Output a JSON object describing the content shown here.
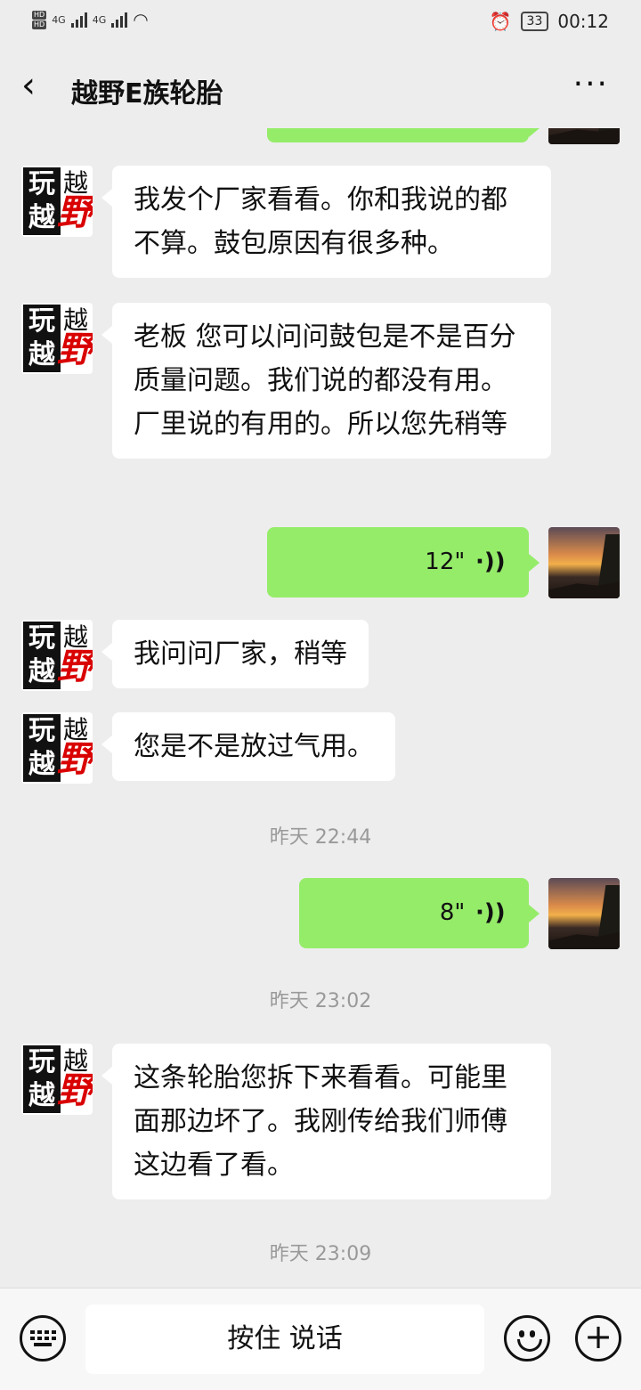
{
  "status_bar": {
    "network_1": "4G",
    "network_2": "4G",
    "hd_label": "HD",
    "battery": "33",
    "time": "00:12"
  },
  "header": {
    "title": "越野E族轮胎",
    "back_icon": "chevron-left-icon",
    "more_icon": "more-dots-icon"
  },
  "messages": [
    {
      "type": "incoming",
      "text": "我发个厂家看看。你和我说的都不算。鼓包原因有很多种。"
    },
    {
      "type": "incoming",
      "text": "老板 您可以问问鼓包是不是百分质量问题。我们说的都没有用。厂里说的有用的。所以您先稍等"
    },
    {
      "type": "outgoing-voice",
      "duration": "12\""
    },
    {
      "type": "incoming",
      "text": "我问问厂家，稍等"
    },
    {
      "type": "incoming",
      "text": "您是不是放过气用。"
    },
    {
      "type": "timestamp",
      "text": "昨天 22:44"
    },
    {
      "type": "outgoing-voice",
      "duration": "8\""
    },
    {
      "type": "timestamp",
      "text": "昨天 23:02"
    },
    {
      "type": "incoming",
      "text": "这条轮胎您拆下来看看。可能里面那边坏了。我刚传给我们师傅这边看了看。"
    },
    {
      "type": "timestamp",
      "text": "昨天 23:09"
    }
  ],
  "contact_avatar": {
    "chars": [
      "玩",
      "越",
      "越",
      "野"
    ]
  },
  "voice_icon": "voice-wave-icon",
  "bottom_bar": {
    "hold_to_talk": "按住 说话",
    "keyboard_icon": "keyboard-icon",
    "emoji_icon": "emoji-icon",
    "plus_icon": "plus-icon"
  },
  "colors": {
    "background": "#ededed",
    "outgoing_bubble": "#95ec69",
    "incoming_bubble": "#ffffff",
    "timestamp": "#999999"
  }
}
